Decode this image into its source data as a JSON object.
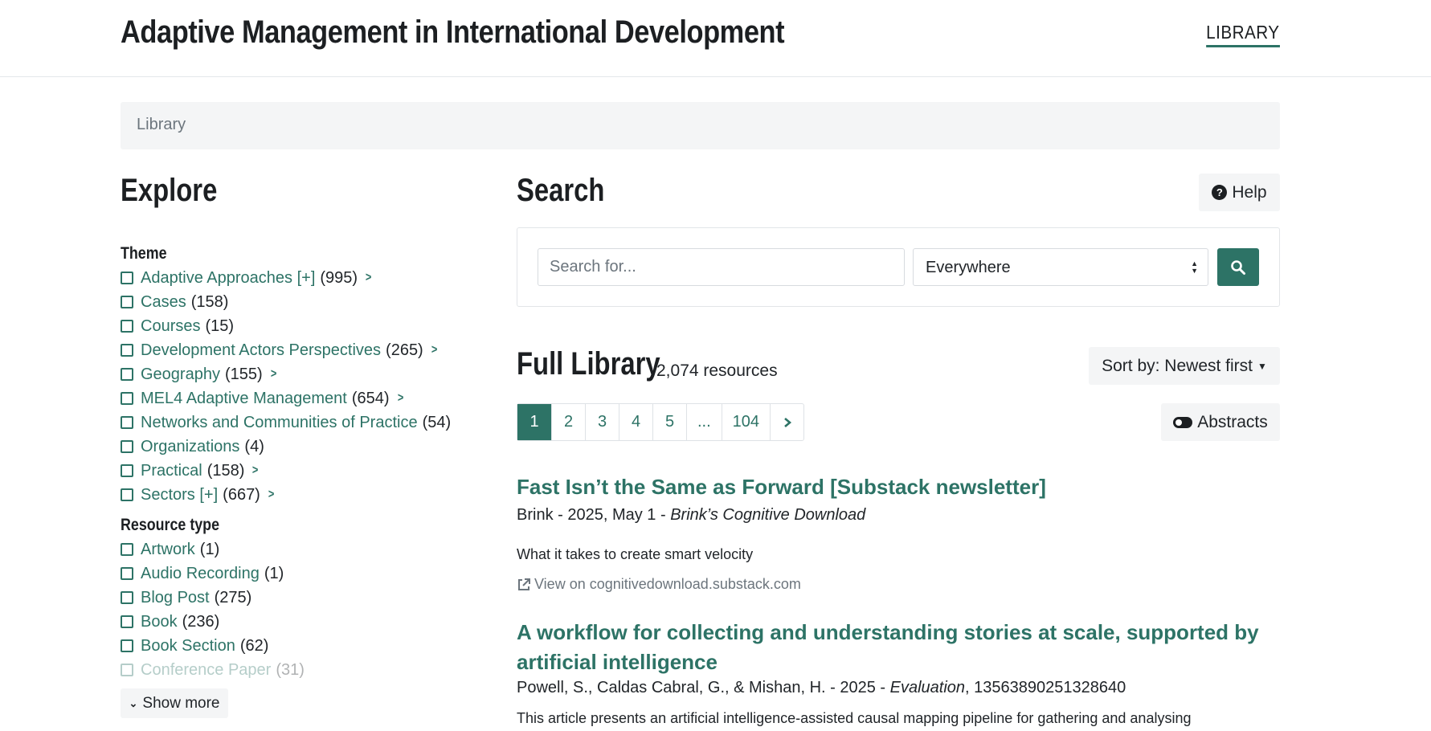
{
  "header": {
    "site_title": "Adaptive Management in International Development",
    "nav_link": "LIBRARY"
  },
  "breadcrumb": "Library",
  "explore": {
    "heading": "Explore",
    "theme": {
      "heading": "Theme",
      "items": [
        {
          "label": "Adaptive Approaches [+]",
          "count": "(995)",
          "expandable": true
        },
        {
          "label": "Cases",
          "count": "(158)",
          "expandable": false
        },
        {
          "label": "Courses",
          "count": "(15)",
          "expandable": false
        },
        {
          "label": "Development Actors Perspectives",
          "count": "(265)",
          "expandable": true
        },
        {
          "label": "Geography",
          "count": "(155)",
          "expandable": true
        },
        {
          "label": "MEL4 Adaptive Management",
          "count": "(654)",
          "expandable": true
        },
        {
          "label": "Networks and Communities of Practice",
          "count": "(54)",
          "expandable": false
        },
        {
          "label": "Organizations",
          "count": "(4)",
          "expandable": false
        },
        {
          "label": "Practical",
          "count": "(158)",
          "expandable": true
        },
        {
          "label": "Sectors [+]",
          "count": "(667)",
          "expandable": true
        }
      ]
    },
    "resource_type": {
      "heading": "Resource type",
      "items": [
        {
          "label": "Artwork",
          "count": "(1)"
        },
        {
          "label": "Audio Recording",
          "count": "(1)"
        },
        {
          "label": "Blog Post",
          "count": "(275)"
        },
        {
          "label": "Book",
          "count": "(236)"
        },
        {
          "label": "Book Section",
          "count": "(62)"
        },
        {
          "label": "Conference Paper",
          "count": "(31)"
        }
      ],
      "show_more": "Show more"
    }
  },
  "search": {
    "heading": "Search",
    "help_label": "Help",
    "placeholder": "Search for...",
    "scope_selected": "Everywhere"
  },
  "library": {
    "heading": "Full Library",
    "count": "2,074 resources",
    "sort_label": "Sort by: Newest first",
    "abstracts_label": "Abstracts",
    "pages": [
      "1",
      "2",
      "3",
      "4",
      "5",
      "...",
      "104"
    ],
    "current_page": "1"
  },
  "results": [
    {
      "title": "Fast Isn’t the Same as Forward [Substack newsletter]",
      "meta_plain": "Brink - 2025, May 1 - ",
      "meta_italic": "Brink’s Cognitive Download",
      "meta_tail": "",
      "abstract": "What it takes to create smart velocity",
      "link": "View on cognitivedownload.substack.com"
    },
    {
      "title": "A workflow for collecting and understanding stories at scale, supported by artificial intelligence",
      "meta_plain": "Powell, S., Caldas Cabral, G., & Mishan, H. - 2025 - ",
      "meta_italic": "Evaluation",
      "meta_tail": ", 13563890251328640",
      "abstract": "This article presents an artificial intelligence-assisted causal mapping pipeline for gathering and analysing"
    }
  ],
  "colors": {
    "accent": "#2d7366",
    "panel": "#f4f5f6",
    "text": "#212529",
    "muted": "#6c757d"
  }
}
